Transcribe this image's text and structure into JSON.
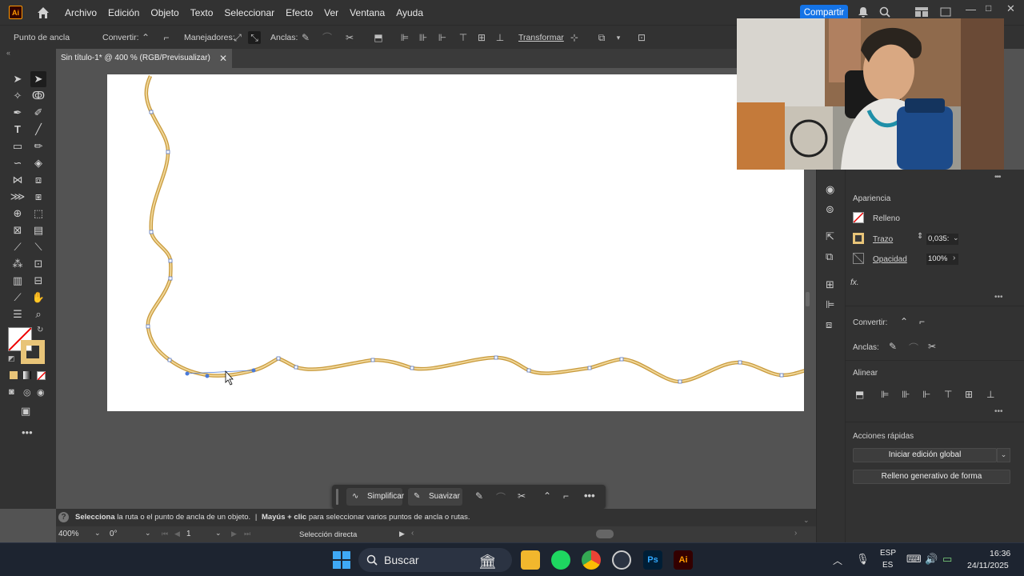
{
  "menubar": {
    "logo": "Ai",
    "items": [
      "Archivo",
      "Edición",
      "Objeto",
      "Texto",
      "Seleccionar",
      "Efecto",
      "Ver",
      "Ventana",
      "Ayuda"
    ],
    "share": "Compartir"
  },
  "controlbar": {
    "tool_label": "Punto de ancla",
    "convert_label": "Convertir:",
    "handles_label": "Manejadores:",
    "anchors_label": "Anclas:",
    "transform_label": "Transformar"
  },
  "document": {
    "tab_title": "Sin título-1* @ 400 % (RGB/Previsualizar)"
  },
  "context_bar": {
    "simplify": "Simplificar",
    "smooth": "Suavizar"
  },
  "status": {
    "hint_bold": "Selecciona",
    "hint_text": "la ruta o el punto de ancla de un objeto.",
    "separator": "|",
    "hint2_bold": "Mayús + clic",
    "hint2_text": "para seleccionar varios puntos de ancla o rutas.",
    "zoom": "400%",
    "rotation": "0°",
    "artboard_num": "1",
    "tool_name": "Selección directa"
  },
  "appearance_panel": {
    "title": "Apariencia",
    "fill_label": "Relleno",
    "stroke_label": "Trazo",
    "stroke_value": "0,035:",
    "opacity_label": "Opacidad",
    "opacity_value": "100%",
    "fx": "fx."
  },
  "anchor_panel": {
    "convert_label": "Convertir:",
    "anchors_label": "Anclas:"
  },
  "align_panel": {
    "title": "Alinear"
  },
  "quick_actions": {
    "title": "Acciones rápidas",
    "global_edit": "Iniciar edición global",
    "generative_fill": "Relleno generativo de forma"
  },
  "taskbar": {
    "search": "Buscar",
    "lang_top": "ESP",
    "lang_bottom": "ES",
    "time": "16:36",
    "date": "24/11/2025"
  },
  "colors": {
    "accent": "#1473e6",
    "path_stroke": "#e8c478",
    "anchor": "#4a7ad8"
  }
}
